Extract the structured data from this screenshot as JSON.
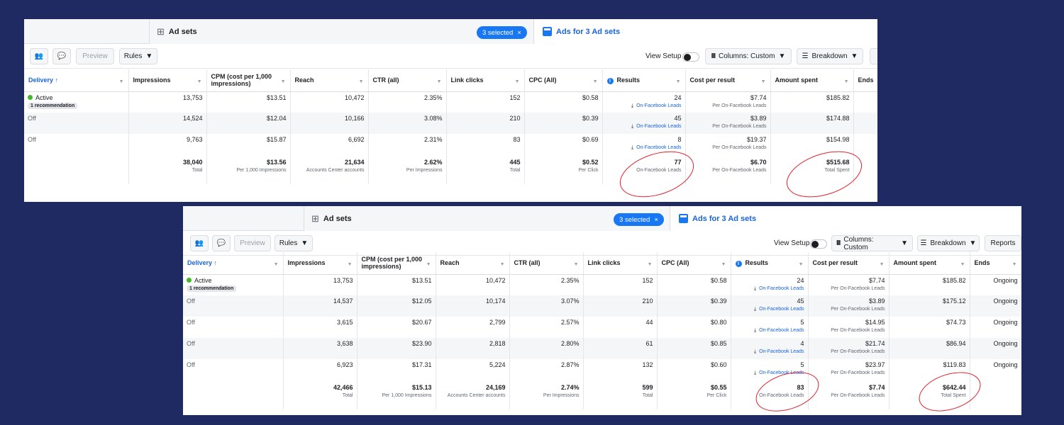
{
  "accent_color": "#1877f2",
  "annotation_color": "#e0202a",
  "icons": [
    "grid-icon",
    "close-icon",
    "ads-square-icon",
    "audience-icon",
    "comment-icon",
    "caret-down-icon",
    "columns-icon",
    "breakdown-icon",
    "info-icon",
    "download-icon",
    "status-dot-icon"
  ],
  "common": {
    "tab_adsets": "Ad sets",
    "selected_pill": "3 selected",
    "close_glyph": "×",
    "tab_ads": "Ads for 3 Ad sets",
    "preview": "Preview",
    "rules": "Rules",
    "view_setup": "View Setup",
    "columns": "Columns: Custom",
    "breakdown": "Breakdown",
    "reports": "Reports",
    "headers": {
      "delivery": "Delivery ↑",
      "impressions": "Impressions",
      "cpm": "CPM (cost per 1,000 impressions)",
      "reach": "Reach",
      "ctr": "CTR (all)",
      "link_clicks": "Link clicks",
      "cpc": "CPC (All)",
      "results": "Results",
      "cost_per_result": "Cost per result",
      "amount_spent": "Amount spent",
      "ends": "Ends"
    },
    "active": "Active",
    "recommendation": "1 recommendation",
    "off": "Off",
    "lead_label": "On-Facebook Leads",
    "per_lead_label": "Per On-Facebook Leads",
    "ongoing": "Ongoing",
    "total_labels": {
      "impressions": "Total",
      "cpm": "Per 1,000 Impressions",
      "reach": "Accounts Center accounts",
      "ctr": "Per Impressions",
      "link_clicks": "Total",
      "cpc": "Per Click",
      "results": "On-Facebook Leads",
      "cost_per_result": "Per On-Facebook Leads",
      "amount_spent": "Total Spent"
    }
  },
  "shot1": {
    "rows": [
      {
        "impressions": "13,753",
        "cpm": "$13.51",
        "reach": "10,472",
        "ctr": "2.35%",
        "link_clicks": "152",
        "cpc": "$0.58",
        "results": "24",
        "cost_per_result": "$7.74",
        "amount_spent": "$185.82"
      },
      {
        "impressions": "14,524",
        "cpm": "$12.04",
        "reach": "10,166",
        "ctr": "3.08%",
        "link_clicks": "210",
        "cpc": "$0.39",
        "results": "45",
        "cost_per_result": "$3.89",
        "amount_spent": "$174.88"
      },
      {
        "impressions": "9,763",
        "cpm": "$15.87",
        "reach": "6,692",
        "ctr": "2.31%",
        "link_clicks": "83",
        "cpc": "$0.69",
        "results": "8",
        "cost_per_result": "$19.37",
        "amount_spent": "$154.98"
      }
    ],
    "totals": {
      "impressions": "38,040",
      "cpm": "$13.56",
      "reach": "21,634",
      "ctr": "2.62%",
      "link_clicks": "445",
      "cpc": "$0.52",
      "results": "77",
      "cost_per_result": "$6.70",
      "amount_spent": "$515.68"
    }
  },
  "shot2": {
    "rows": [
      {
        "impressions": "13,753",
        "cpm": "$13.51",
        "reach": "10,472",
        "ctr": "2.35%",
        "link_clicks": "152",
        "cpc": "$0.58",
        "results": "24",
        "cost_per_result": "$7.74",
        "amount_spent": "$185.82",
        "ends": "Ongoing"
      },
      {
        "impressions": "14,537",
        "cpm": "$12.05",
        "reach": "10,174",
        "ctr": "3.07%",
        "link_clicks": "210",
        "cpc": "$0.39",
        "results": "45",
        "cost_per_result": "$3.89",
        "amount_spent": "$175.12",
        "ends": "Ongoing"
      },
      {
        "impressions": "3,615",
        "cpm": "$20.67",
        "reach": "2,799",
        "ctr": "2.57%",
        "link_clicks": "44",
        "cpc": "$0.80",
        "results": "5",
        "cost_per_result": "$14.95",
        "amount_spent": "$74.73",
        "ends": "Ongoing"
      },
      {
        "impressions": "3,638",
        "cpm": "$23.90",
        "reach": "2,818",
        "ctr": "2.80%",
        "link_clicks": "61",
        "cpc": "$0.85",
        "results": "4",
        "cost_per_result": "$21.74",
        "amount_spent": "$86.94",
        "ends": "Ongoing"
      },
      {
        "impressions": "6,923",
        "cpm": "$17.31",
        "reach": "5,224",
        "ctr": "2.87%",
        "link_clicks": "132",
        "cpc": "$0.60",
        "results": "5",
        "cost_per_result": "$23.97",
        "amount_spent": "$119.83",
        "ends": "Ongoing"
      }
    ],
    "totals": {
      "impressions": "42,466",
      "cpm": "$15.13",
      "reach": "24,169",
      "ctr": "2.74%",
      "link_clicks": "599",
      "cpc": "$0.55",
      "results": "83",
      "cost_per_result": "$7.74",
      "amount_spent": "$642.44"
    }
  }
}
